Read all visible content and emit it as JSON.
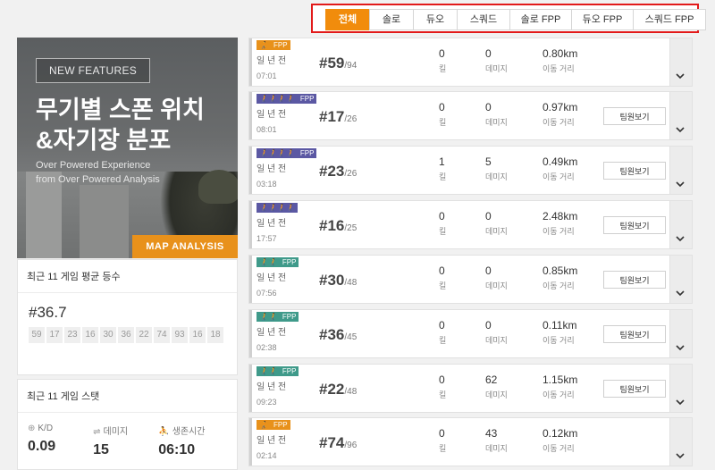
{
  "tabs": [
    "전체",
    "솔로",
    "듀오",
    "스쿼드",
    "솔로 FPP",
    "듀오 FPP",
    "스쿼드 FPP"
  ],
  "tab_widths": [
    48,
    48,
    48,
    58,
    68,
    68,
    80
  ],
  "active_tab": 0,
  "banner": {
    "badge": "NEW FEATURES",
    "title_line1": "무기별 스폰 위치",
    "title_line2": "&자기장 분포",
    "sub_line1": "Over Powered Experience",
    "sub_line2": "from Over Powered Analysis",
    "button": "MAP ANALYSIS"
  },
  "avg_rank": {
    "heading": "최근 11 게임 평균 등수",
    "value": "#36.7",
    "ranks": [
      "59",
      "17",
      "23",
      "16",
      "30",
      "36",
      "22",
      "74",
      "93",
      "16",
      "18"
    ]
  },
  "stats": {
    "heading": "최근 11 게임 스탯",
    "items": [
      {
        "icon": "⊕",
        "label": "K/D",
        "value": "0.09"
      },
      {
        "icon": "⇌",
        "label": "데미지",
        "value": "15"
      },
      {
        "icon": "⛹",
        "label": "생존시간",
        "value": "06:10"
      }
    ]
  },
  "colors": {
    "solo": "#e8911b",
    "squad": "#5b58a3",
    "duo": "#3f9a8a",
    "fpp": "#4e4f55"
  },
  "matches": [
    {
      "mode": "solo",
      "mode_tag": "🚶",
      "fpp": true,
      "ago": "일 년 전",
      "time": "07:01",
      "rank": "#59",
      "total": "/94",
      "kills": "0",
      "damage": "0",
      "distance": "0.80km",
      "team_btn": false
    },
    {
      "mode": "squad",
      "mode_tag": "🚶🚶🚶🚶",
      "fpp": true,
      "ago": "일 년 전",
      "time": "08:01",
      "rank": "#17",
      "total": "/26",
      "kills": "0",
      "damage": "0",
      "distance": "0.97km",
      "team_btn": true
    },
    {
      "mode": "squad",
      "mode_tag": "🚶🚶🚶🚶",
      "fpp": true,
      "ago": "일 년 전",
      "time": "03:18",
      "rank": "#23",
      "total": "/26",
      "kills": "1",
      "damage": "5",
      "distance": "0.49km",
      "team_btn": true
    },
    {
      "mode": "squad",
      "mode_tag": "🚶🚶🚶🚶",
      "fpp": false,
      "ago": "일 년 전",
      "time": "17:57",
      "rank": "#16",
      "total": "/25",
      "kills": "0",
      "damage": "0",
      "distance": "2.48km",
      "team_btn": true
    },
    {
      "mode": "duo",
      "mode_tag": "🚶🚶",
      "fpp": true,
      "ago": "일 년 전",
      "time": "07:56",
      "rank": "#30",
      "total": "/48",
      "kills": "0",
      "damage": "0",
      "distance": "0.85km",
      "team_btn": true
    },
    {
      "mode": "duo",
      "mode_tag": "🚶🚶",
      "fpp": true,
      "ago": "일 년 전",
      "time": "02:38",
      "rank": "#36",
      "total": "/45",
      "kills": "0",
      "damage": "0",
      "distance": "0.11km",
      "team_btn": true
    },
    {
      "mode": "duo",
      "mode_tag": "🚶🚶",
      "fpp": true,
      "ago": "일 년 전",
      "time": "09:23",
      "rank": "#22",
      "total": "/48",
      "kills": "0",
      "damage": "62",
      "distance": "1.15km",
      "team_btn": true
    },
    {
      "mode": "solo",
      "mode_tag": "🚶",
      "fpp": true,
      "ago": "일 년 전",
      "time": "02:14",
      "rank": "#74",
      "total": "/96",
      "kills": "0",
      "damage": "43",
      "distance": "0.12km",
      "team_btn": false
    }
  ],
  "labels": {
    "fpp": "FPP",
    "kills": "킬",
    "damage": "데미지",
    "distance": "이동 거리",
    "team_btn": "팀원보기"
  }
}
